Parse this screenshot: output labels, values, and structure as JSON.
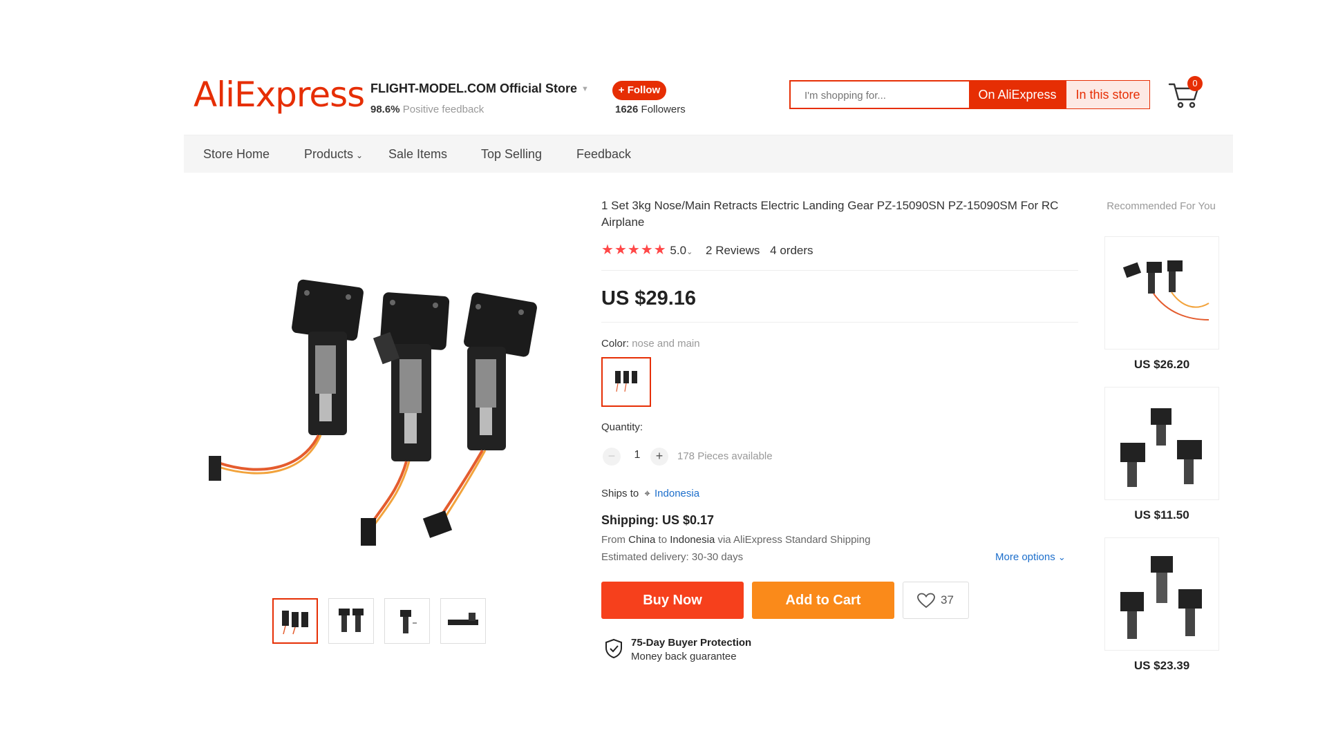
{
  "header": {
    "logo": "AliExpress",
    "store_name": "FLIGHT-MODEL.COM Official Store",
    "feedback_percent": "98.6%",
    "feedback_label": "Positive feedback",
    "follow_label": "+ Follow",
    "followers_count": "1626",
    "followers_label": "Followers",
    "search_placeholder": "I'm shopping for...",
    "search_on_aliexpress": "On AliExpress",
    "search_in_store": "In this store",
    "cart_count": "0"
  },
  "nav": {
    "items": [
      "Store Home",
      "Products",
      "Sale Items",
      "Top Selling",
      "Feedback"
    ]
  },
  "product": {
    "title": "1 Set 3kg Nose/Main Retracts Electric Landing Gear PZ-15090SN PZ-15090SM For RC Airplane",
    "rating": "5.0",
    "reviews": "2 Reviews",
    "orders": "4 orders",
    "price": "US $29.16",
    "color_label": "Color:",
    "color_value": "nose and main",
    "quantity_label": "Quantity:",
    "quantity": "1",
    "available": "178 Pieces available",
    "ships_to_label": "Ships to",
    "ships_to_country": "Indonesia",
    "shipping": "Shipping: US $0.17",
    "route_from": "From",
    "route_origin": "China",
    "route_to": "to",
    "route_dest": "Indonesia",
    "route_via": "via AliExpress Standard Shipping",
    "delivery": "Estimated delivery: 30-30 days",
    "more_options": "More options",
    "buy_now": "Buy Now",
    "add_to_cart": "Add to Cart",
    "wishlist_count": "37",
    "protection_title": "75-Day Buyer Protection",
    "protection_sub": "Money back guarantee"
  },
  "recommended": {
    "title": "Recommended For You",
    "items": [
      {
        "price": "US $26.20"
      },
      {
        "price": "US $11.50"
      },
      {
        "price": "US $23.39"
      }
    ]
  },
  "colors": {
    "brand": "#e62e04",
    "buy_now": "#f6401c",
    "add_to_cart": "#fa8a1a",
    "star": "#ff4747",
    "link": "#1c6ecb"
  }
}
